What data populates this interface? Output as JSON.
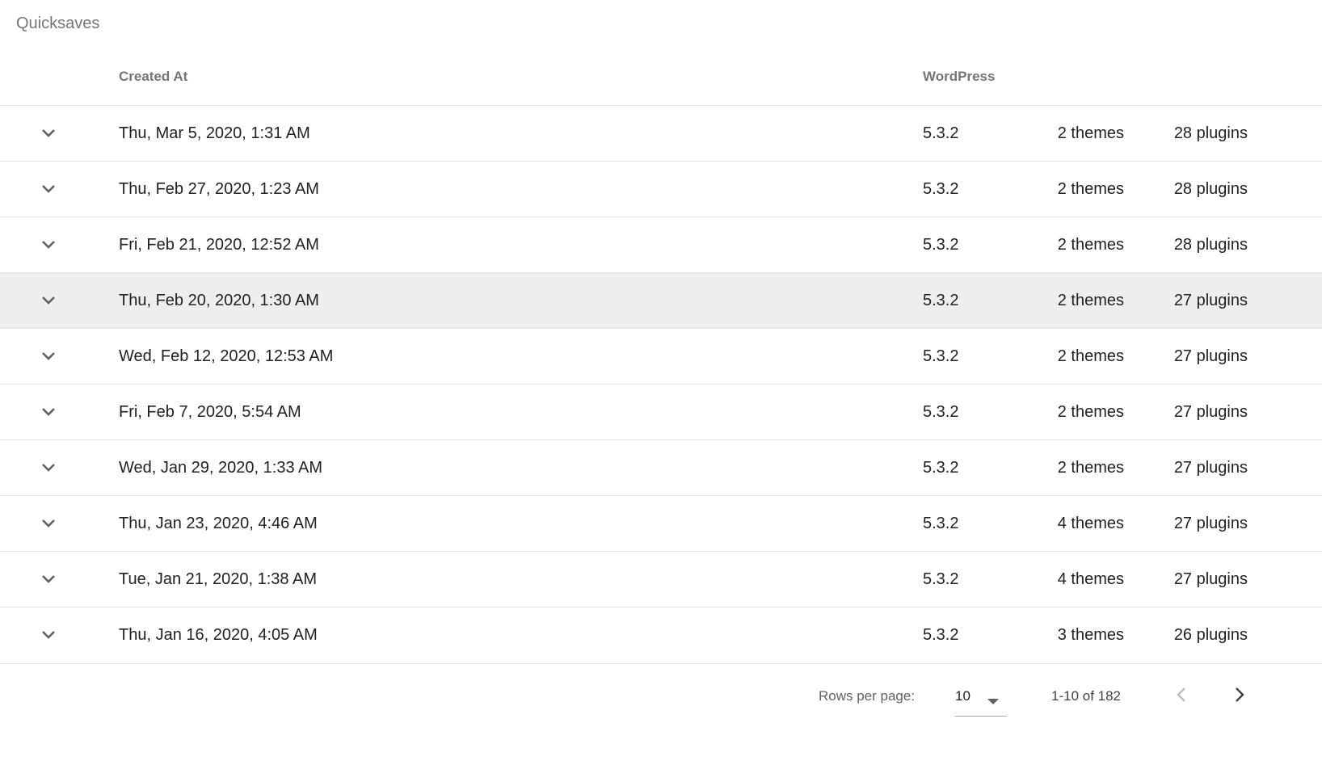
{
  "title": "Quicksaves",
  "columns": {
    "created_at": "Created At",
    "wordpress": "WordPress"
  },
  "rows": [
    {
      "date": "Thu, Mar 5, 2020, 1:31 AM",
      "wp": "5.3.2",
      "themes": "2 themes",
      "plugins": "28 plugins"
    },
    {
      "date": "Thu, Feb 27, 2020, 1:23 AM",
      "wp": "5.3.2",
      "themes": "2 themes",
      "plugins": "28 plugins"
    },
    {
      "date": "Fri, Feb 21, 2020, 12:52 AM",
      "wp": "5.3.2",
      "themes": "2 themes",
      "plugins": "28 plugins"
    },
    {
      "date": "Thu, Feb 20, 2020, 1:30 AM",
      "wp": "5.3.2",
      "themes": "2 themes",
      "plugins": "27 plugins"
    },
    {
      "date": "Wed, Feb 12, 2020, 12:53 AM",
      "wp": "5.3.2",
      "themes": "2 themes",
      "plugins": "27 plugins"
    },
    {
      "date": "Fri, Feb 7, 2020, 5:54 AM",
      "wp": "5.3.2",
      "themes": "2 themes",
      "plugins": "27 plugins"
    },
    {
      "date": "Wed, Jan 29, 2020, 1:33 AM",
      "wp": "5.3.2",
      "themes": "2 themes",
      "plugins": "27 plugins"
    },
    {
      "date": "Thu, Jan 23, 2020, 4:46 AM",
      "wp": "5.3.2",
      "themes": "4 themes",
      "plugins": "27 plugins"
    },
    {
      "date": "Tue, Jan 21, 2020, 1:38 AM",
      "wp": "5.3.2",
      "themes": "4 themes",
      "plugins": "27 plugins"
    },
    {
      "date": "Thu, Jan 16, 2020, 4:05 AM",
      "wp": "5.3.2",
      "themes": "3 themes",
      "plugins": "26 plugins"
    }
  ],
  "highlighted_row": 3,
  "footer": {
    "rows_per_page_label": "Rows per page:",
    "rows_per_page_value": "10",
    "page_info": "1-10 of 182"
  },
  "icons": {
    "expand": "chevron-down-icon",
    "dropdown": "arrow-drop-down-icon",
    "prev": "chevron-left-icon",
    "next": "chevron-right-icon"
  },
  "colors": {
    "highlight_row": "#eeeeee",
    "divider": "#e0e0e0",
    "header_text": "#757575"
  }
}
